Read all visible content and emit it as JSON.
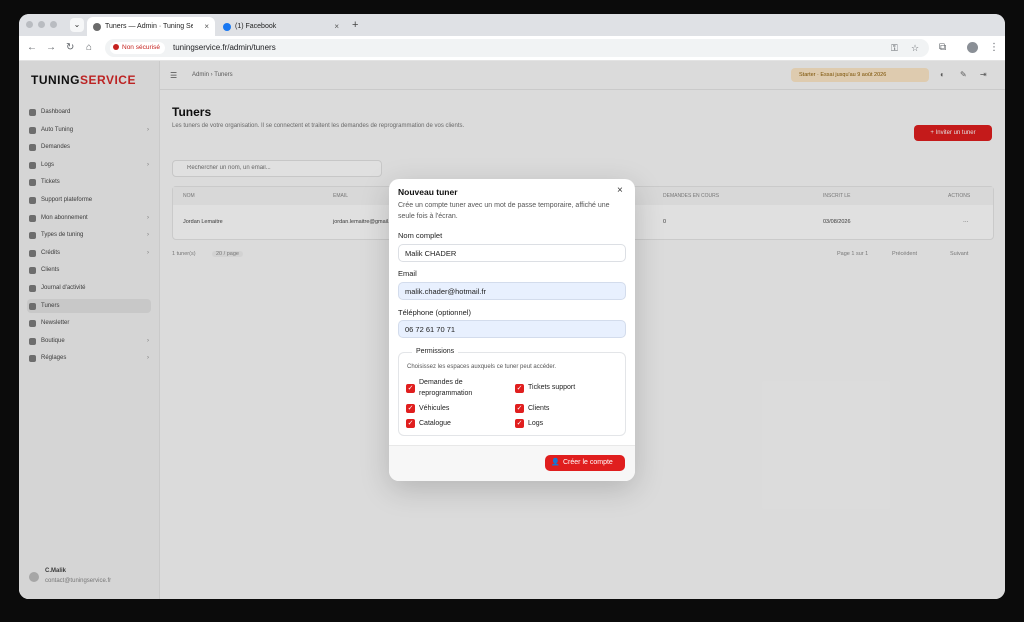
{
  "browser": {
    "tabs": [
      {
        "title": "Tuners — Admin · Tuning Service",
        "close": "×"
      },
      {
        "title": "(1) Facebook",
        "close": "×"
      }
    ],
    "new_tab": "+",
    "tab_menu": "⌄",
    "nav": {
      "back": "←",
      "forward": "→",
      "reload": "↻",
      "home": "⌂"
    },
    "security_label": "Non sécurisé",
    "url": "tuningservice.fr/admin/tuners",
    "icons": [
      "key-icon",
      "star-icon",
      "extensions-icon",
      "profile-avatar",
      "menu-icon"
    ]
  },
  "app": {
    "logo_part1": "TUNING",
    "logo_part2": "SERVICE",
    "sidebar": [
      {
        "label": "Dashboard"
      },
      {
        "label": "Auto Tuning",
        "chevron": "›"
      },
      {
        "label": "Demandes"
      },
      {
        "label": "Logs",
        "chevron": "›"
      },
      {
        "label": "Tickets"
      },
      {
        "label": "Support plateforme"
      },
      {
        "label": "Mon abonnement",
        "chevron": "›"
      },
      {
        "label": "Types de tuning",
        "chevron": "›"
      },
      {
        "label": "Crédits",
        "chevron": "›"
      },
      {
        "label": "Clients"
      },
      {
        "label": "Journal d'activité"
      },
      {
        "label": "Tuners",
        "active": true
      },
      {
        "label": "Newsletter"
      },
      {
        "label": "Boutique",
        "chevron": "›"
      },
      {
        "label": "Réglages",
        "chevron": "›"
      }
    ],
    "user": {
      "name": "C.Malik",
      "email": "contact@tuningservice.fr"
    },
    "breadcrumb": "Admin  ›  Tuners",
    "plan_badge": "Starter · Essai jusqu'au 9 août 2026",
    "page_title": "Tuners",
    "page_subtitle": "Les tuners de votre organisation. Il se connectent et traitent les demandes de reprogrammation de vos clients.",
    "invite_button": "+ Inviter un tuner",
    "search_placeholder": "Rechercher un nom, un email...",
    "table": {
      "headers": [
        "NOM",
        "EMAIL",
        "DEMANDES EN COURS",
        "INSCRIT LE",
        "ACTIONS"
      ],
      "rows": [
        [
          "Jordan Lemaitre",
          "jordan.lemaitre@gmail.com",
          "0",
          "03/08/2026",
          "···"
        ]
      ]
    },
    "pagination": {
      "count": "1 tuner(s)",
      "per_page": "20 / page",
      "page": "Page 1 sur 1",
      "prev": "Précédent",
      "next": "Suivant"
    }
  },
  "modal": {
    "title": "Nouveau tuner",
    "close": "×",
    "description": "Crée un compte tuner avec un mot de passe temporaire, affiché une seule fois à l'écran.",
    "fields": [
      {
        "label": "Nom complet",
        "value": "Malik CHADER"
      },
      {
        "label": "Email",
        "value": "malik.chader@hotmail.fr"
      },
      {
        "label": "Téléphone (optionnel)",
        "value": "06 72 61 70 71"
      }
    ],
    "permissions": {
      "legend": "Permissions",
      "help": "Choisissez les espaces auxquels ce tuner peut accéder.",
      "items": [
        {
          "label": "Demandes de reprogrammation",
          "checked": true
        },
        {
          "label": "Tickets support",
          "checked": true
        },
        {
          "label": "Véhicules",
          "checked": true
        },
        {
          "label": "Clients",
          "checked": true
        },
        {
          "label": "Catalogue",
          "checked": true
        },
        {
          "label": "Logs",
          "checked": true
        }
      ]
    },
    "submit": "Créer le compte",
    "submit_icon": "user-plus-icon"
  },
  "colors": {
    "accent": "#e01e1e",
    "input_filled": "#e8f0fe",
    "overlay": "rgba(0,0,0,0.12)"
  }
}
